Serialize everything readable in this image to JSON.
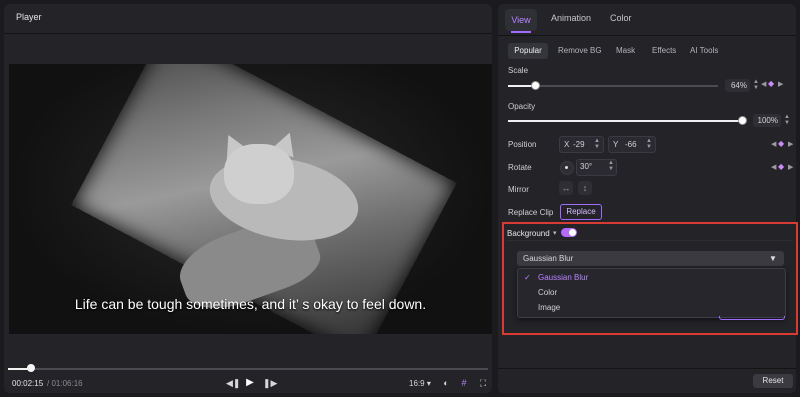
{
  "player": {
    "title": "Player",
    "subtitle": "Life can be tough sometimes, and it’ s okay to feel down.",
    "time_current": "00:02:15",
    "time_total": "/ 01:06:16",
    "progress_fraction": 0.048,
    "aspect_ratio": "16:9",
    "icons": [
      "prev-frame-icon",
      "play-icon",
      "next-frame-icon",
      "camera-icon",
      "grid-icon",
      "fullscreen-icon"
    ]
  },
  "panel": {
    "tabs": [
      "View",
      "Animation",
      "Color"
    ],
    "active_tab": "View",
    "subtabs": [
      "Popular",
      "Remove BG",
      "Mask",
      "Effects",
      "AI Tools"
    ],
    "active_subtab": "Popular",
    "scale": {
      "label": "Scale",
      "value": "64%",
      "level": 0.64
    },
    "opacity": {
      "label": "Opacity",
      "value": "100%",
      "level": 1.0
    },
    "position": {
      "label": "Position",
      "x_label": "X",
      "x_value": "-29",
      "y_label": "Y",
      "y_value": "-66"
    },
    "rotate": {
      "label": "Rotate",
      "value": "30°"
    },
    "mirror": {
      "label": "Mirror"
    },
    "replace_clip": {
      "label": "Replace Clip",
      "button": "Replace"
    },
    "background": {
      "label": "Background",
      "enabled": true,
      "selected": "Gaussian Blur",
      "options": [
        "Gaussian Blur",
        "Color",
        "Image"
      ]
    },
    "reset": "Reset"
  },
  "colors": {
    "accent": "#b884ff",
    "highlight_border": "#d93a34",
    "panel_bg": "#232328",
    "app_bg": "#1b1b1f"
  }
}
